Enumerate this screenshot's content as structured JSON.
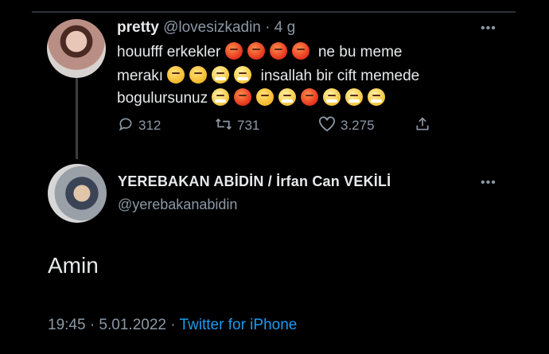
{
  "tweet1": {
    "display_name": "pretty",
    "handle": "@lovesizkadin",
    "separator": "·",
    "time": "4 g",
    "menu": "•••",
    "text_segments": {
      "l1a": "houufff erkekler",
      "l1b": "ne bu meme",
      "l2a": "merakı",
      "l2b": "insallah bir cift memede",
      "l3a": "bogulursunuz"
    },
    "emoji_names": [
      "angry-face-emoji",
      "unamused-face-emoji",
      "face-with-steam-emoji"
    ],
    "stats": {
      "replies": "312",
      "retweets": "731",
      "likes": "3.275"
    },
    "icons": {
      "reply": "reply-icon",
      "retweet": "retweet-icon",
      "like": "heart-icon",
      "share": "share-icon"
    }
  },
  "tweet2": {
    "display_name": "YEREBAKAN ABİDİN / İrfan Can VEKİLİ",
    "handle": "@yerebakanabidin",
    "menu": "•••",
    "text": "Amin",
    "timestamp": "19:45 · 5.01.2022 · ",
    "source": "Twitter for iPhone"
  },
  "colors": {
    "background": "#000000",
    "text": "#e7e9ea",
    "muted": "#8b98a5",
    "link": "#1d9bf0"
  }
}
